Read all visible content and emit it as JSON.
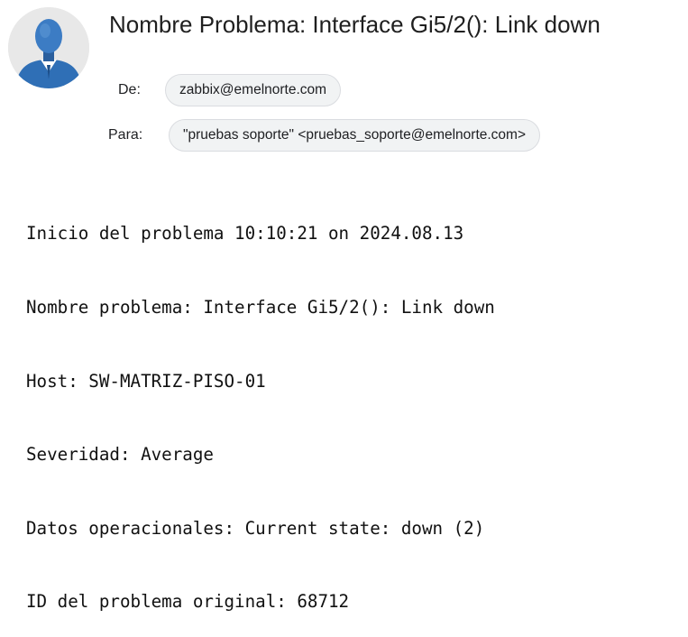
{
  "email": {
    "subject": "Nombre Problema: Interface Gi5/2(): Link down",
    "from_label": "De:",
    "from_value": "zabbix@emelnorte.com",
    "to_label": "Para:",
    "to_value": "\"pruebas soporte\" <pruebas_soporte@emelnorte.com>",
    "avatar_icon": "user-avatar-icon",
    "body_lines": [
      "Inicio del problema 10:10:21 on 2024.08.13",
      "Nombre problema: Interface Gi5/2(): Link down",
      "Host: SW-MATRIZ-PISO-01",
      "Severidad: Average",
      "Datos operacionales: Current state: down (2)",
      "ID del problema original: 68712"
    ]
  },
  "colors": {
    "avatar_shirt": "#2f6fb6",
    "avatar_bg": "#e8e8e8",
    "chip_bg": "#f1f3f4",
    "chip_border": "#dadce0"
  }
}
